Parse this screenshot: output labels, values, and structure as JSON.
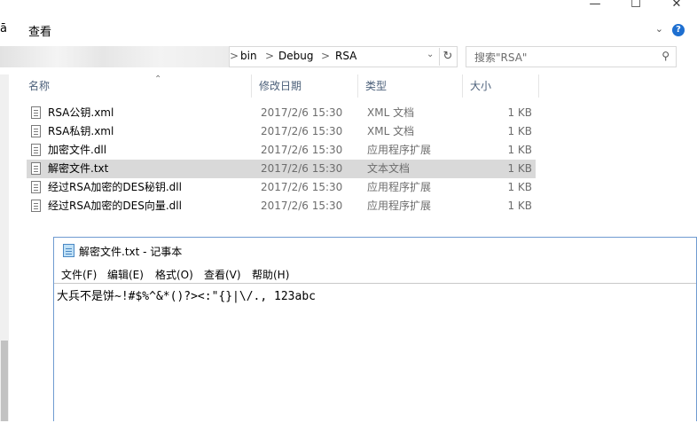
{
  "window_controls": {
    "minimize": "—",
    "maximize": "☐",
    "close": "✕"
  },
  "ribbon": {
    "left_tab": " ",
    "view_tab": "查看",
    "help": "?"
  },
  "address": {
    "crumbs": [
      "bin",
      "Debug",
      "RSA"
    ],
    "separator": ">"
  },
  "search": {
    "placeholder": "搜索\"RSA\""
  },
  "columns": {
    "name": "名称",
    "date": "修改日期",
    "type": "类型",
    "size": "大小"
  },
  "files": [
    {
      "name": "RSA公钥.xml",
      "date": "2017/2/6 15:30",
      "type": "XML 文档",
      "size": "1 KB",
      "selected": false
    },
    {
      "name": "RSA私钥.xml",
      "date": "2017/2/6 15:30",
      "type": "XML 文档",
      "size": "1 KB",
      "selected": false
    },
    {
      "name": "加密文件.dll",
      "date": "2017/2/6 15:30",
      "type": "应用程序扩展",
      "size": "1 KB",
      "selected": false
    },
    {
      "name": "解密文件.txt",
      "date": "2017/2/6 15:30",
      "type": "文本文档",
      "size": "1 KB",
      "selected": true
    },
    {
      "name": "经过RSA加密的DES秘钥.dll",
      "date": "2017/2/6 15:30",
      "type": "应用程序扩展",
      "size": "1 KB",
      "selected": false
    },
    {
      "name": "经过RSA加密的DES向量.dll",
      "date": "2017/2/6 15:30",
      "type": "应用程序扩展",
      "size": "1 KB",
      "selected": false
    }
  ],
  "notepad": {
    "title": "解密文件.txt - 记事本",
    "menus": [
      "文件(F)",
      "编辑(E)",
      "格式(O)",
      "查看(V)",
      "帮助(H)"
    ],
    "content": "大兵不是饼~!#$%^&*()?><:\"{}|\\/., 123abc"
  }
}
